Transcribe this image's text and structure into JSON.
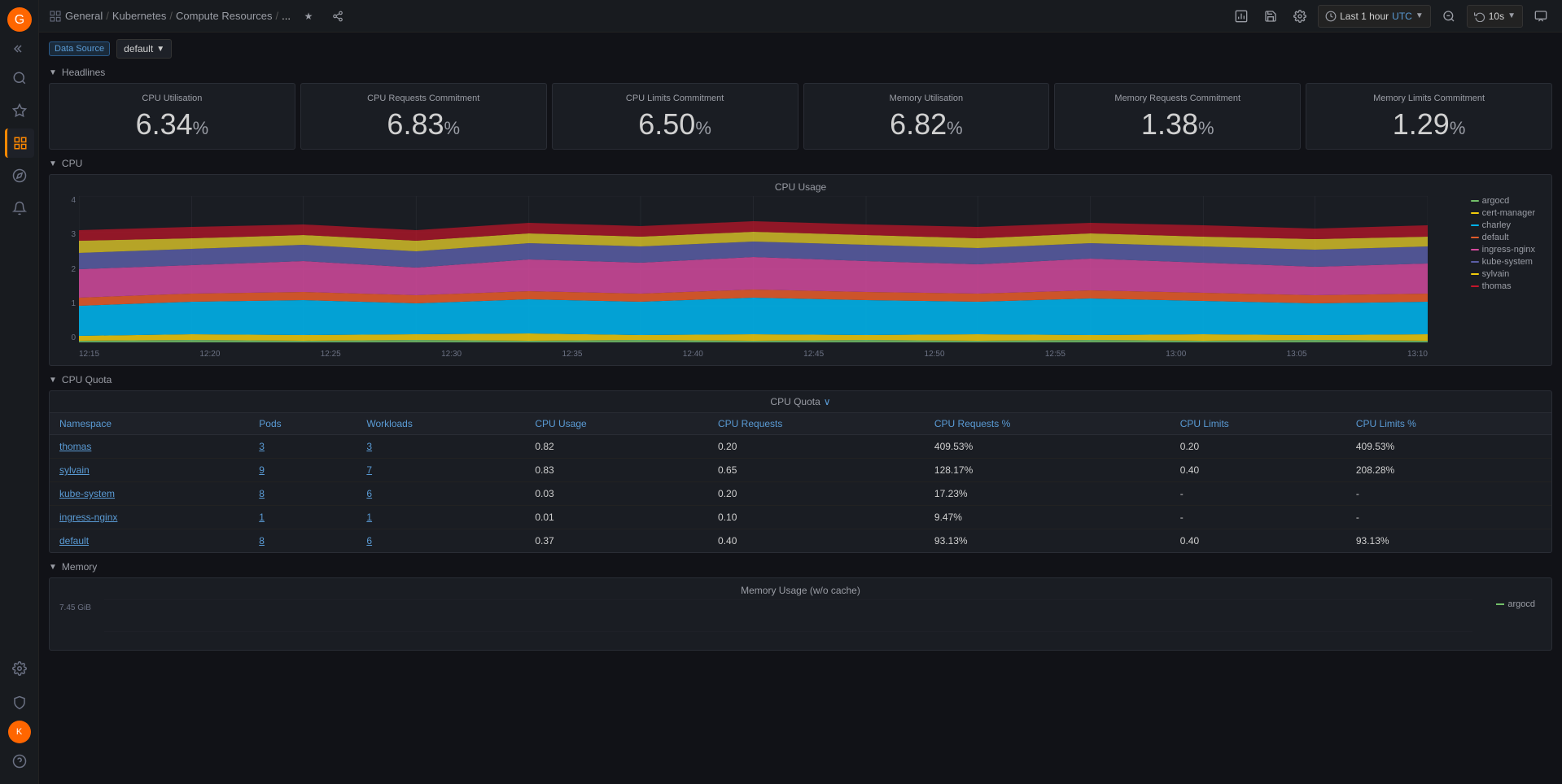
{
  "app": {
    "logo_text": "G",
    "sidebar_toggle_label": "<<",
    "breadcrumb": [
      "General",
      "Kubernetes",
      "Compute Resources",
      "..."
    ],
    "breadcrumb_separator": "/",
    "star_label": "★",
    "share_label": "⋯"
  },
  "topbar": {
    "time_range": "Last 1 hour",
    "timezone": "UTC",
    "zoom_icon": "🔍",
    "refresh_icon": "↻",
    "refresh_interval": "10s",
    "chat_icon": "💬",
    "bar_chart_icon": "📊",
    "grid_icon": "⊞",
    "settings_icon": "⚙"
  },
  "filter": {
    "label": "Data Source",
    "value": "default",
    "dropdown_arrow": "▼"
  },
  "sections": {
    "headlines": "Headlines",
    "cpu": "CPU",
    "cpu_quota": "CPU Quota",
    "memory": "Memory"
  },
  "stat_cards": [
    {
      "title": "CPU Utilisation",
      "value": "6.34",
      "unit": "%"
    },
    {
      "title": "CPU Requests Commitment",
      "value": "6.83",
      "unit": "%"
    },
    {
      "title": "CPU Limits Commitment",
      "value": "6.50",
      "unit": "%"
    },
    {
      "title": "Memory Utilisation",
      "value": "6.82",
      "unit": "%"
    },
    {
      "title": "Memory Requests Commitment",
      "value": "1.38",
      "unit": "%"
    },
    {
      "title": "Memory Limits Commitment",
      "value": "1.29",
      "unit": "%"
    }
  ],
  "cpu_chart": {
    "title": "CPU Usage",
    "y_labels": [
      "4",
      "3",
      "2",
      "1",
      "0"
    ],
    "x_labels": [
      "12:15",
      "12:20",
      "12:25",
      "12:30",
      "12:35",
      "12:40",
      "12:45",
      "12:50",
      "12:55",
      "13:00",
      "13:05",
      "13:10"
    ],
    "legend": [
      {
        "name": "argocd",
        "color": "#73BF69"
      },
      {
        "name": "cert-manager",
        "color": "#F2CC0C"
      },
      {
        "name": "charley",
        "color": "#01B0E8"
      },
      {
        "name": "default",
        "color": "#E05B2B"
      },
      {
        "name": "ingress-nginx",
        "color": "#D44A9D"
      },
      {
        "name": "kube-system",
        "color": "#5B5EA6"
      },
      {
        "name": "sylvain",
        "color": "#F2CC0C"
      },
      {
        "name": "thomas",
        "color": "#C4162A"
      }
    ]
  },
  "cpu_quota_table": {
    "title": "CPU Quota",
    "dropdown_arrow": "∨",
    "columns": [
      "Namespace",
      "Pods",
      "Workloads",
      "CPU Usage",
      "CPU Requests",
      "CPU Requests %",
      "CPU Limits",
      "CPU Limits %"
    ],
    "rows": [
      {
        "namespace": "thomas",
        "pods": "3",
        "workloads": "3",
        "cpu_usage": "0.82",
        "cpu_requests": "0.20",
        "cpu_requests_pct": "409.53%",
        "cpu_limits": "0.20",
        "cpu_limits_pct": "409.53%"
      },
      {
        "namespace": "sylvain",
        "pods": "9",
        "workloads": "7",
        "cpu_usage": "0.83",
        "cpu_requests": "0.65",
        "cpu_requests_pct": "128.17%",
        "cpu_limits": "0.40",
        "cpu_limits_pct": "208.28%"
      },
      {
        "namespace": "kube-system",
        "pods": "8",
        "workloads": "6",
        "cpu_usage": "0.03",
        "cpu_requests": "0.20",
        "cpu_requests_pct": "17.23%",
        "cpu_limits": "-",
        "cpu_limits_pct": "-"
      },
      {
        "namespace": "ingress-nginx",
        "pods": "1",
        "workloads": "1",
        "cpu_usage": "0.01",
        "cpu_requests": "0.10",
        "cpu_requests_pct": "9.47%",
        "cpu_limits": "-",
        "cpu_limits_pct": "-"
      },
      {
        "namespace": "default",
        "pods": "8",
        "workloads": "6",
        "cpu_usage": "0.37",
        "cpu_requests": "0.40",
        "cpu_requests_pct": "93.13%",
        "cpu_limits": "0.40",
        "cpu_limits_pct": "93.13%"
      }
    ]
  },
  "memory_chart": {
    "title": "Memory Usage (w/o cache)",
    "y_label": "7.45 GiB",
    "legend_item": "argocd",
    "legend_color": "#73BF69"
  }
}
